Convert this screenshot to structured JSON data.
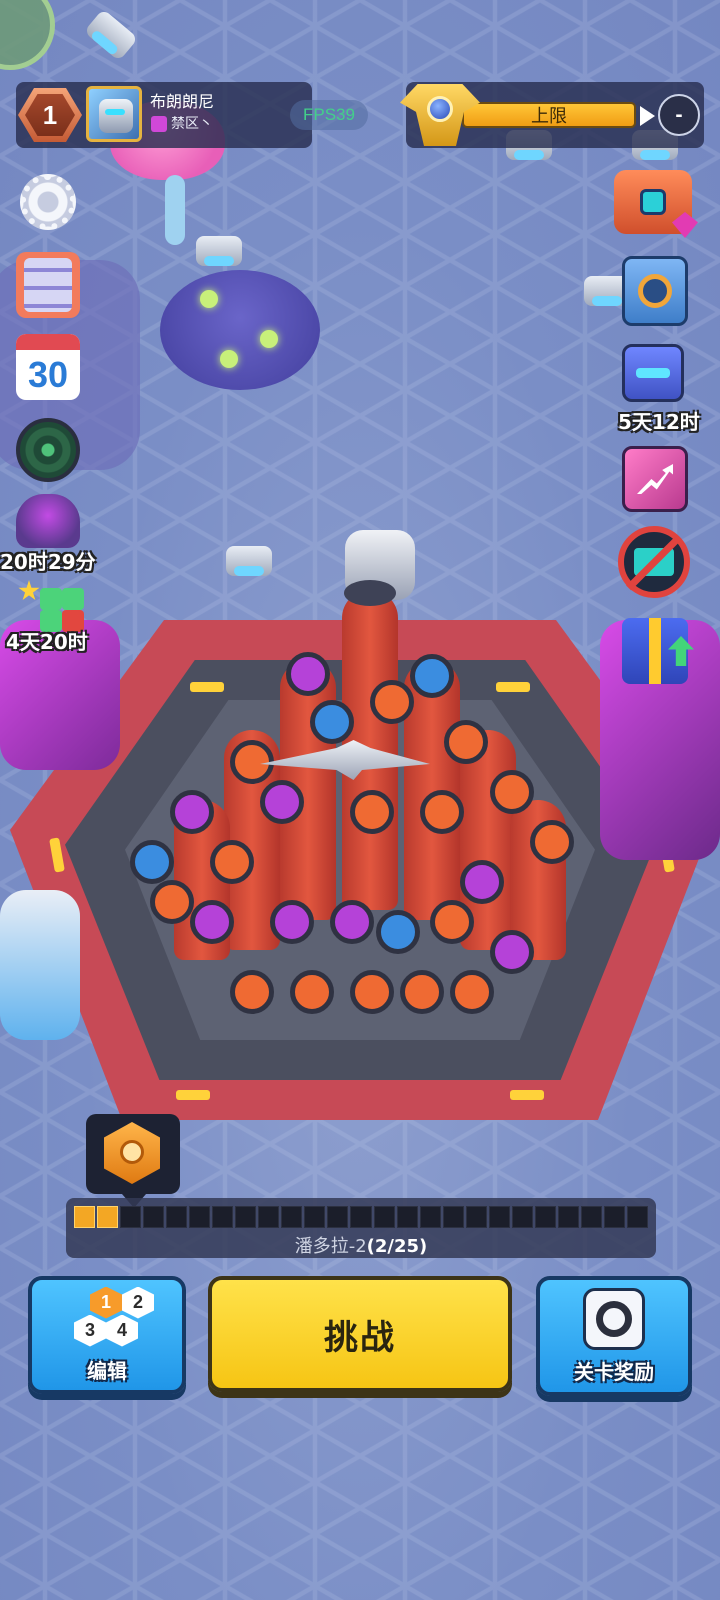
{
  "player": {
    "level": "1",
    "name": "布朗朗尼",
    "zone": "禁区丶",
    "avatar_icon": "mech-avatar"
  },
  "fps": "FPS39",
  "rank": {
    "label": "上限",
    "circle_text": "-",
    "emblem_icon": "rank-emblem"
  },
  "left_column": {
    "settings_icon": "gear-icon",
    "tasks_icon": "clipboard-icon",
    "calendar_day": "30",
    "radar_icon": "radar-icon",
    "monster_timer": "20时29分",
    "blocks_timer": "4天20时"
  },
  "right_column": {
    "shop_icon": "chest-icon",
    "vault_icon": "safe-icon",
    "pass_timer": "5天12时",
    "growth_icon": "chart-up-icon",
    "no_ads_icon": "no-ads-icon",
    "gift_icon": "gift-icon"
  },
  "progress": {
    "stage_name": "潘多拉-2",
    "count": "(2/25)",
    "current": 2,
    "total": 25
  },
  "buttons": {
    "edit_label": "编辑",
    "edit_slots": [
      "1",
      "2",
      "3",
      "4"
    ],
    "challenge_label": "挑战",
    "reward_label": "关卡奖励"
  },
  "colors": {
    "challenge": "#f6c514",
    "side_buttons": "#2096e8",
    "progress_fill": "#f3a724",
    "fortress_red": "#c74a56"
  }
}
